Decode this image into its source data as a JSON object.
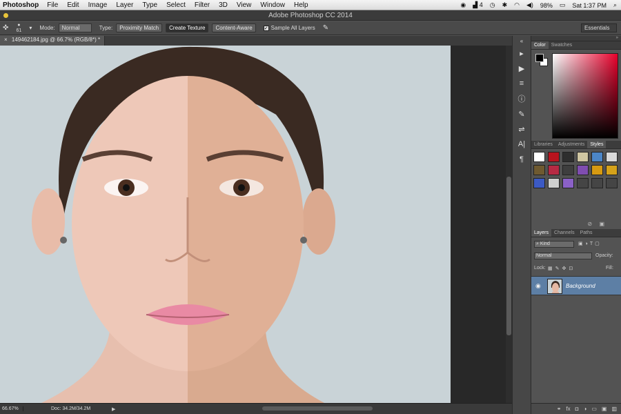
{
  "menubar": {
    "app_name": "Photoshop",
    "items": [
      "File",
      "Edit",
      "Image",
      "Layer",
      "Type",
      "Select",
      "Filter",
      "3D",
      "View",
      "Window",
      "Help"
    ],
    "status_right": {
      "adobe_count": "4",
      "battery": "98%",
      "clock": "Sat 1:37 PM"
    }
  },
  "window": {
    "title": "Adobe Photoshop CC 2014"
  },
  "options": {
    "brush_size": "61",
    "mode_label": "Mode:",
    "mode_value": "Normal",
    "type_label": "Type:",
    "type_buttons": [
      "Proximity Match",
      "Create Texture",
      "Content-Aware"
    ],
    "type_selected": "Create Texture",
    "sample_all_layers": "Sample All Layers",
    "workspace": "Essentials"
  },
  "document": {
    "tab_title": "149462184.jpg @ 66.7% (RGB/8*) *"
  },
  "status": {
    "zoom": "66.67%",
    "doc_size": "Doc: 34.2M/34.2M"
  },
  "color_panel": {
    "tabs": [
      "Color",
      "Swatches"
    ],
    "foreground": "#000000",
    "background": "#ffffff",
    "hue": "#e8002b"
  },
  "styles_panel": {
    "tabs": [
      "Libraries",
      "Adjustments",
      "Styles"
    ],
    "swatch_colors": [
      "#ffffff",
      "#b8141e",
      "#2e2e2e",
      "#cfc6a2",
      "#4c86c7",
      "#d9d9d9",
      "#6f5a30",
      "#b62a43",
      "#3e3e3e",
      "#7f4db0",
      "#d69a12",
      "#d5a21a",
      "#3c5ac4",
      "#cfd0cf",
      "#8b61c7",
      "#454545",
      "#454545",
      "#454545"
    ]
  },
  "layers_panel": {
    "tabs": [
      "Layers",
      "Channels",
      "Paths"
    ],
    "kind_label": "Kind",
    "blend_mode": "Normal",
    "opacity_label": "Opacity:",
    "lock_label": "Lock:",
    "fill_label": "Fill:",
    "layers": [
      {
        "name": "Background"
      }
    ]
  }
}
